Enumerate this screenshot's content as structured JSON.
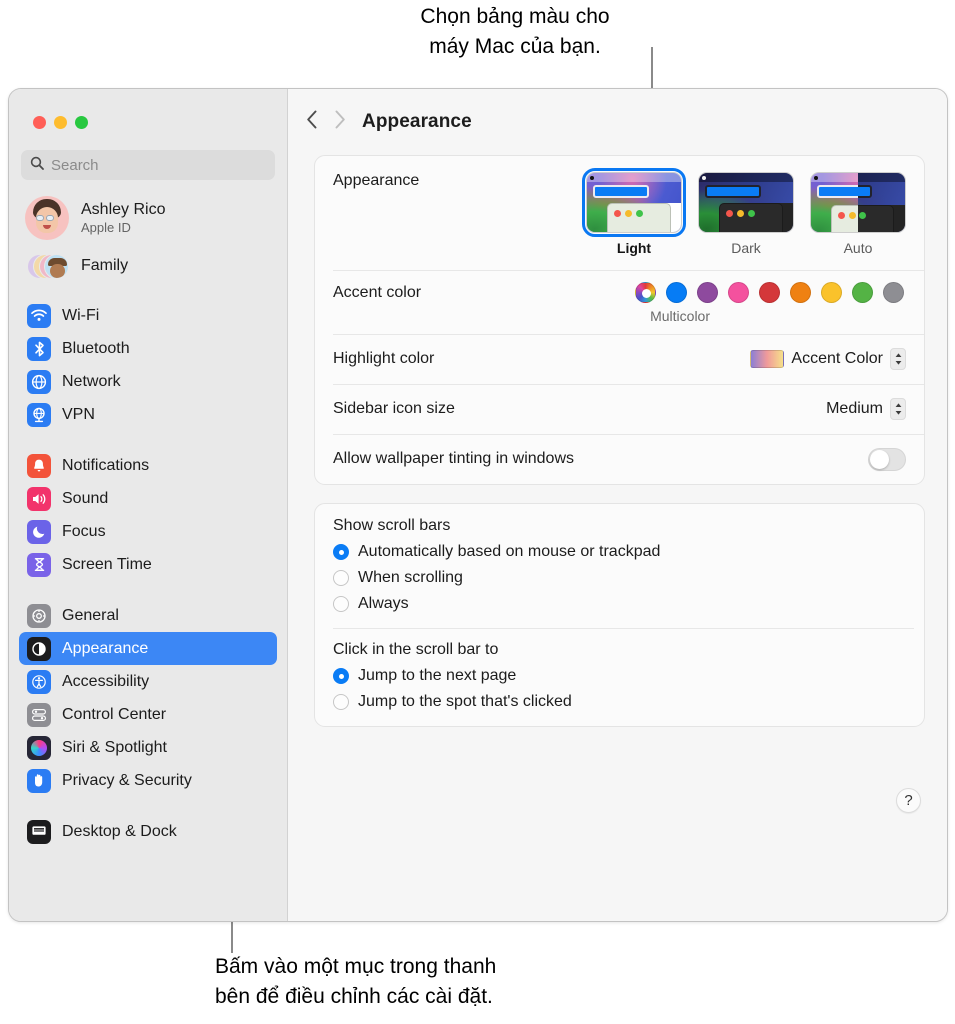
{
  "callouts": {
    "top": "Chọn bảng màu cho\nmáy Mac của bạn.",
    "bottom": "Bấm vào một mục trong thanh\nbên để điều chỉnh các cài đặt."
  },
  "window": {
    "title": "Appearance",
    "traffic_lights": [
      "close",
      "minimize",
      "zoom"
    ]
  },
  "sidebar": {
    "search": {
      "placeholder": "Search",
      "value": ""
    },
    "profile": {
      "name": "Ashley Rico",
      "subtitle": "Apple ID"
    },
    "family": {
      "label": "Family"
    },
    "groups": [
      {
        "items": [
          {
            "label": "Wi-Fi",
            "icon": "wifi-icon",
            "color": "#2b7cf3"
          },
          {
            "label": "Bluetooth",
            "icon": "bluetooth-icon",
            "color": "#2b7cf3"
          },
          {
            "label": "Network",
            "icon": "globe-icon",
            "color": "#2b7cf3"
          },
          {
            "label": "VPN",
            "icon": "vpn-icon",
            "color": "#2b7cf3"
          }
        ]
      },
      {
        "items": [
          {
            "label": "Notifications",
            "icon": "bell-icon",
            "color": "#f3533a"
          },
          {
            "label": "Sound",
            "icon": "speaker-icon",
            "color": "#f2336b"
          },
          {
            "label": "Focus",
            "icon": "moon-icon",
            "color": "#6b63e8"
          },
          {
            "label": "Screen Time",
            "icon": "hourglass-icon",
            "color": "#7a63e8"
          }
        ]
      },
      {
        "items": [
          {
            "label": "General",
            "icon": "gear-icon",
            "color": "#8e8e93"
          },
          {
            "label": "Appearance",
            "icon": "contrast-icon",
            "color": "#1c1c1e",
            "selected": true
          },
          {
            "label": "Accessibility",
            "icon": "accessibility-icon",
            "color": "#2b7cf3"
          },
          {
            "label": "Control Center",
            "icon": "control-center-icon",
            "color": "#8e8e93"
          },
          {
            "label": "Siri & Spotlight",
            "icon": "siri-icon",
            "color": "#2b2b3c"
          },
          {
            "label": "Privacy & Security",
            "icon": "hand-icon",
            "color": "#2b7cf3"
          }
        ]
      },
      {
        "items": [
          {
            "label": "Desktop & Dock",
            "icon": "desktop-icon",
            "color": "#1c1c1e"
          }
        ]
      }
    ]
  },
  "main": {
    "appearance": {
      "label": "Appearance",
      "options": [
        {
          "label": "Light",
          "mode": "light",
          "selected": true
        },
        {
          "label": "Dark",
          "mode": "dark",
          "selected": false
        },
        {
          "label": "Auto",
          "mode": "auto",
          "selected": false
        }
      ]
    },
    "accent_color": {
      "label": "Accent color",
      "caption": "Multicolor",
      "swatches": [
        {
          "name": "multicolor",
          "color": "multi",
          "selected": true
        },
        {
          "name": "blue",
          "color": "#067cf5"
        },
        {
          "name": "purple",
          "color": "#8e4a9e"
        },
        {
          "name": "pink",
          "color": "#f4519e"
        },
        {
          "name": "red",
          "color": "#d4373a"
        },
        {
          "name": "orange",
          "color": "#ef8112"
        },
        {
          "name": "yellow",
          "color": "#fac22b"
        },
        {
          "name": "green",
          "color": "#54b345"
        },
        {
          "name": "graphite",
          "color": "#8e8e93"
        }
      ]
    },
    "highlight_color": {
      "label": "Highlight color",
      "value": "Accent Color"
    },
    "sidebar_icon_size": {
      "label": "Sidebar icon size",
      "value": "Medium"
    },
    "wallpaper_tinting": {
      "label": "Allow wallpaper tinting in windows",
      "enabled": false
    },
    "show_scroll_bars": {
      "title": "Show scroll bars",
      "options": [
        {
          "label": "Automatically based on mouse or trackpad",
          "selected": true
        },
        {
          "label": "When scrolling",
          "selected": false
        },
        {
          "label": "Always",
          "selected": false
        }
      ]
    },
    "click_scroll_bar": {
      "title": "Click in the scroll bar to",
      "options": [
        {
          "label": "Jump to the next page",
          "selected": true
        },
        {
          "label": "Jump to the spot that's clicked",
          "selected": false
        }
      ]
    },
    "help_label": "?"
  }
}
